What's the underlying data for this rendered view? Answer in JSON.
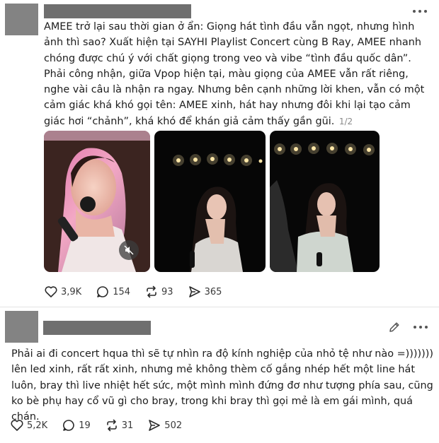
{
  "post1": {
    "text": "AMEE trở lại sau thời gian ở ẩn: Giọng hát tình đầu vẫn ngọt, nhưng hình ảnh thì sao? Xuất hiện tại SAYHI Playlist Concert cùng B Ray, AMEE nhanh chóng được chú ý với chất giọng trong veo và vibe “tình đầu quốc dân”. Phải công nhận, giữa Vpop hiện tại, màu giọng của AMEE vẫn rất riêng, nghe vài câu là nhận ra ngay. Nhưng bên cạnh những lời khen, vẫn có một cảm giác khá khó gọi tên: AMEE xinh, hát hay nhưng đôi khi lại tạo cảm giác hơi “chảnh”, khá khó để khán giả cảm thấy gần gũi.",
    "page_counter": "1/2",
    "likes": "3,9K",
    "comments": "154",
    "reposts": "93",
    "shares": "365"
  },
  "post2": {
    "text": "Phải ai đi concert hqua thì sẽ tự nhìn ra độ kính nghiệp của nhỏ tệ như nào =))))))) lên led xinh, rất rất xinh, nhưng mẻ không thèm cố gắng nhép hết một line hát luôn, bray thì live nhiệt hết sức, một mình mình đứng đơ như tượng phía sau, cũng ko bè phụ hay cổ vũ gì cho bray, trong khi bray thì gọi mẻ là em gái mình, quá chán.",
    "likes": "5,2K",
    "comments": "19",
    "reposts": "31",
    "shares": "502"
  },
  "icons": {
    "more": "more-horizontal-icon",
    "edit": "pencil-icon",
    "like": "heart-icon",
    "comment": "comment-bubble-icon",
    "repost": "repost-icon",
    "share": "send-icon",
    "mute": "muted-speaker-icon"
  },
  "colors": {
    "redaction": "#6f6f6f",
    "avatar_redaction": "#838383",
    "text": "#1c1c1c",
    "muted": "#8a8a8a"
  }
}
